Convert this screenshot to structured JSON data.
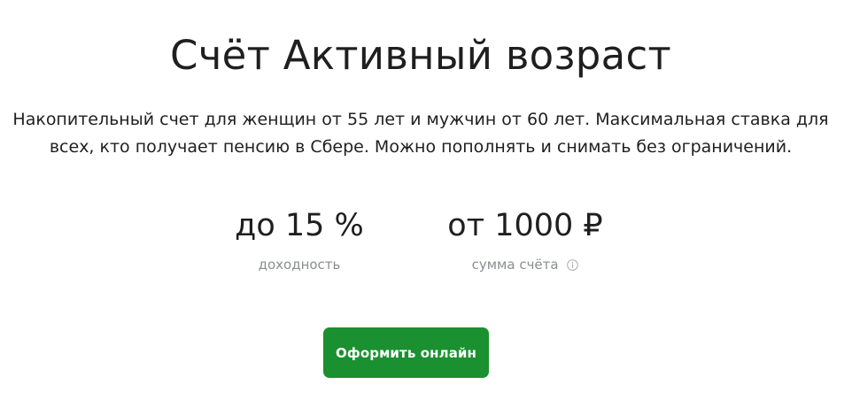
{
  "product": {
    "title": "Счёт Активный возраст",
    "description": "Накопительный счет для женщин от 55 лет и мужчин от 60 лет. Максимальная ставка для всех, кто получает пенсию в Сбере. Можно пополнять и снимать без ограничений."
  },
  "stats": {
    "rate": {
      "value": "до 15 %",
      "caption": "доходность"
    },
    "amount": {
      "value": "от 1000 ₽",
      "caption": "сумма счёта",
      "icon": "info-icon"
    }
  },
  "cta": {
    "label": "Оформить онлайн"
  },
  "colors": {
    "brand_green": "#1a9030",
    "text": "#1f1f1f",
    "caption": "#8a8d90"
  }
}
